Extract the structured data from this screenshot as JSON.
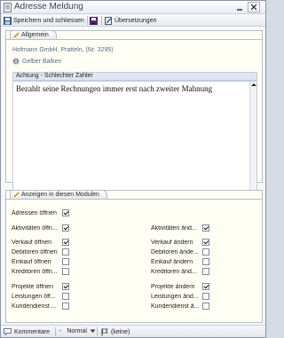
{
  "window": {
    "title": "Adresse Meldung"
  },
  "toolbar": {
    "save_close_label": "Speichern und schliessen",
    "translations_label": "Übersetzungen"
  },
  "general": {
    "tab_label": "Allgemein",
    "company": "Hofmann GmbH, Pratteln, (Nr. 3295)",
    "status": "Gelber Balken",
    "note_title": "Achtung - Schlechter Zahler",
    "note_text": "Bezahlt seine Rechnungen immer erst nach zweiter Mahnung"
  },
  "modules": {
    "tab_label": "Anzeigen in diesen Modulen",
    "items": [
      {
        "label": "Adressen öffnen",
        "checked": true
      },
      {
        "label": "Aktivitäten öffn...",
        "checked": true
      },
      {
        "label": "Aktivitäten änd...",
        "checked": true
      },
      {
        "label": "Verkauf öffnen",
        "checked": true
      },
      {
        "label": "Verkauf ändern",
        "checked": true
      },
      {
        "label": "Debitoren öffnen",
        "checked": false
      },
      {
        "label": "Debitoren ände...",
        "checked": false
      },
      {
        "label": "Einkauf öffnen",
        "checked": false
      },
      {
        "label": "Einkauf ändern",
        "checked": false
      },
      {
        "label": "Kreditoren öffn...",
        "checked": false
      },
      {
        "label": "Kreditoren änd...",
        "checked": false
      },
      {
        "label": "Projekte öffnen",
        "checked": true
      },
      {
        "label": "Projekte ändern",
        "checked": true
      },
      {
        "label": "Leistungen öff...",
        "checked": false
      },
      {
        "label": "Leistungen änd...",
        "checked": false
      },
      {
        "label": "Kundendienst ...",
        "checked": false
      },
      {
        "label": "Kundendienst ä...",
        "checked": false
      }
    ]
  },
  "statusbar": {
    "comments_label": "Kommentare",
    "priority_label": "Normal",
    "flag_label": "(keine)"
  },
  "colors": {
    "accent": "#5a6b8a",
    "note_header": "#dfe6f2",
    "panel_bg": "#fffef4"
  }
}
